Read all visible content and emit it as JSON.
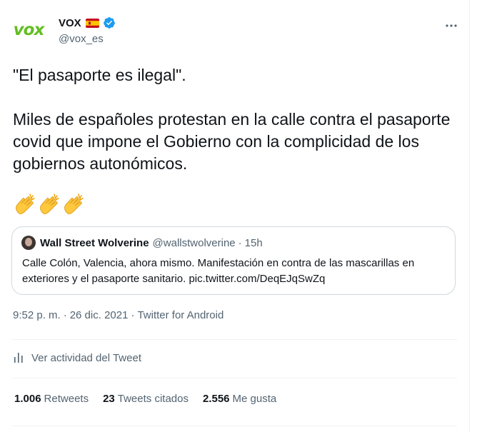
{
  "author": {
    "name": "VOX",
    "handle": "@vox_es",
    "logo_text": "vox",
    "colors": {
      "logo": "#63be21",
      "verified": "#1d9bf0"
    }
  },
  "tweet": {
    "paragraph_1": "\"El pasaporte es ilegal\".",
    "paragraph_2": "Miles de españoles protestan en la calle contra el pasaporte covid que impone el Gobierno con la complicidad de los gobiernos autonómicos.",
    "emojis": [
      "clapping-hands",
      "clapping-hands",
      "clapping-hands"
    ]
  },
  "quoted": {
    "name": "Wall Street Wolverine",
    "handle": "@wallstwolverine",
    "separator": "·",
    "time": "15h",
    "text": "Calle Colón, Valencia, ahora mismo. Manifestación en contra de las mascarillas en exteriores y el pasaporte sanitario. pic.twitter.com/DeqEJqSwZq"
  },
  "meta": {
    "time": "9:52 p. m.",
    "sep": "·",
    "date": "26 dic. 2021",
    "source": "Twitter for Android"
  },
  "activity": {
    "label": "Ver actividad del Tweet"
  },
  "stats": {
    "retweets_count": "1.006",
    "retweets_label": "Retweets",
    "quotes_count": "23",
    "quotes_label": "Tweets citados",
    "likes_count": "2.556",
    "likes_label": "Me gusta"
  }
}
